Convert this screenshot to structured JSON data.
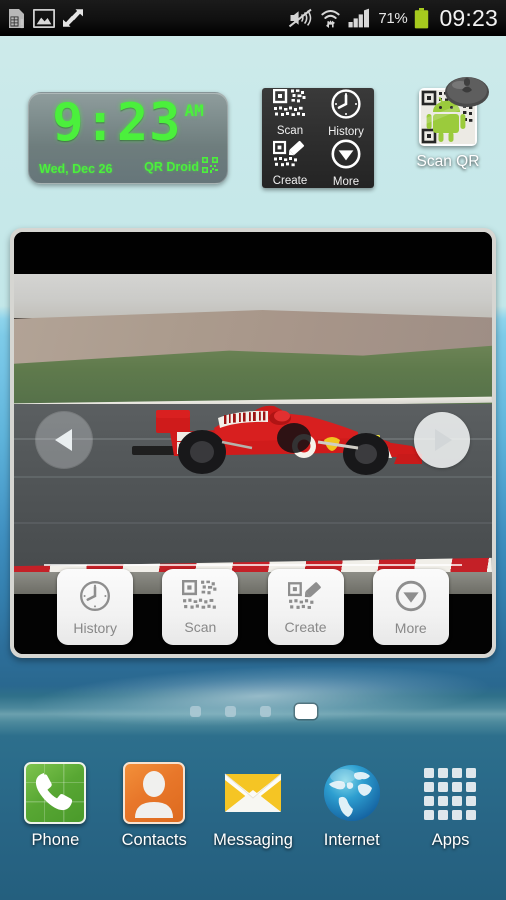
{
  "status_bar": {
    "left_icons": [
      "sim-card-icon",
      "gallery-image-icon",
      "sync-transfer-icon"
    ],
    "right_icons": [
      "sound-mute-vibrate-icon",
      "wifi-data-transfer-icon",
      "cellular-signal-icon",
      "battery-icon"
    ],
    "battery_percent": "71%",
    "clock": "09:23",
    "background_color": "#101010",
    "text_color": "#f2f2f2"
  },
  "clock_widget": {
    "time": "9:23",
    "ampm": "AM",
    "date": "Wed, Dec 26",
    "brand": "QR Droid",
    "brand_icon": "qr-code-icon",
    "digit_color": "#4bf03c",
    "panel_color": "#7e8d8d"
  },
  "qr_widget": {
    "background_color": "#2e2e2e",
    "cells": [
      {
        "label": "Scan",
        "icon": "qr-code-icon"
      },
      {
        "label": "History",
        "icon": "clock-icon"
      },
      {
        "label": "Create",
        "icon": "qr-pencil-icon"
      },
      {
        "label": "More",
        "icon": "chevron-down-circle-icon"
      }
    ]
  },
  "scan_qr_shortcut": {
    "label": "Scan QR",
    "icon": "android-qr-icon",
    "overlay_icon": "magnifier-lens-icon"
  },
  "photo_widget": {
    "image_description": "Red Formula 1 Ferrari race car on track",
    "prev_button": "previous-photo-arrow",
    "next_button": "next-photo-arrow",
    "frame_color": "#d6d6d2",
    "toolbar": [
      {
        "label": "History",
        "icon": "clock-icon"
      },
      {
        "label": "Scan",
        "icon": "qr-code-icon"
      },
      {
        "label": "Create",
        "icon": "qr-pencil-icon"
      },
      {
        "label": "More",
        "icon": "chevron-down-circle-icon"
      }
    ]
  },
  "page_indicator": {
    "total": 4,
    "active_index": 3
  },
  "dock": {
    "items": [
      {
        "label": "Phone",
        "icon": "phone-handset-icon",
        "color": "#58a733"
      },
      {
        "label": "Contacts",
        "icon": "person-icon",
        "color": "#e8772a"
      },
      {
        "label": "Messaging",
        "icon": "envelope-icon",
        "color": "#f4c430"
      },
      {
        "label": "Internet",
        "icon": "globe-icon",
        "color": "#2b8fd1"
      },
      {
        "label": "Apps",
        "icon": "apps-grid-icon",
        "color": "#dfe6ea"
      }
    ]
  },
  "wallpaper": {
    "top_color": "#cdeaea",
    "mid_color": "#5fb4db",
    "bottom_color": "#245f7e"
  }
}
